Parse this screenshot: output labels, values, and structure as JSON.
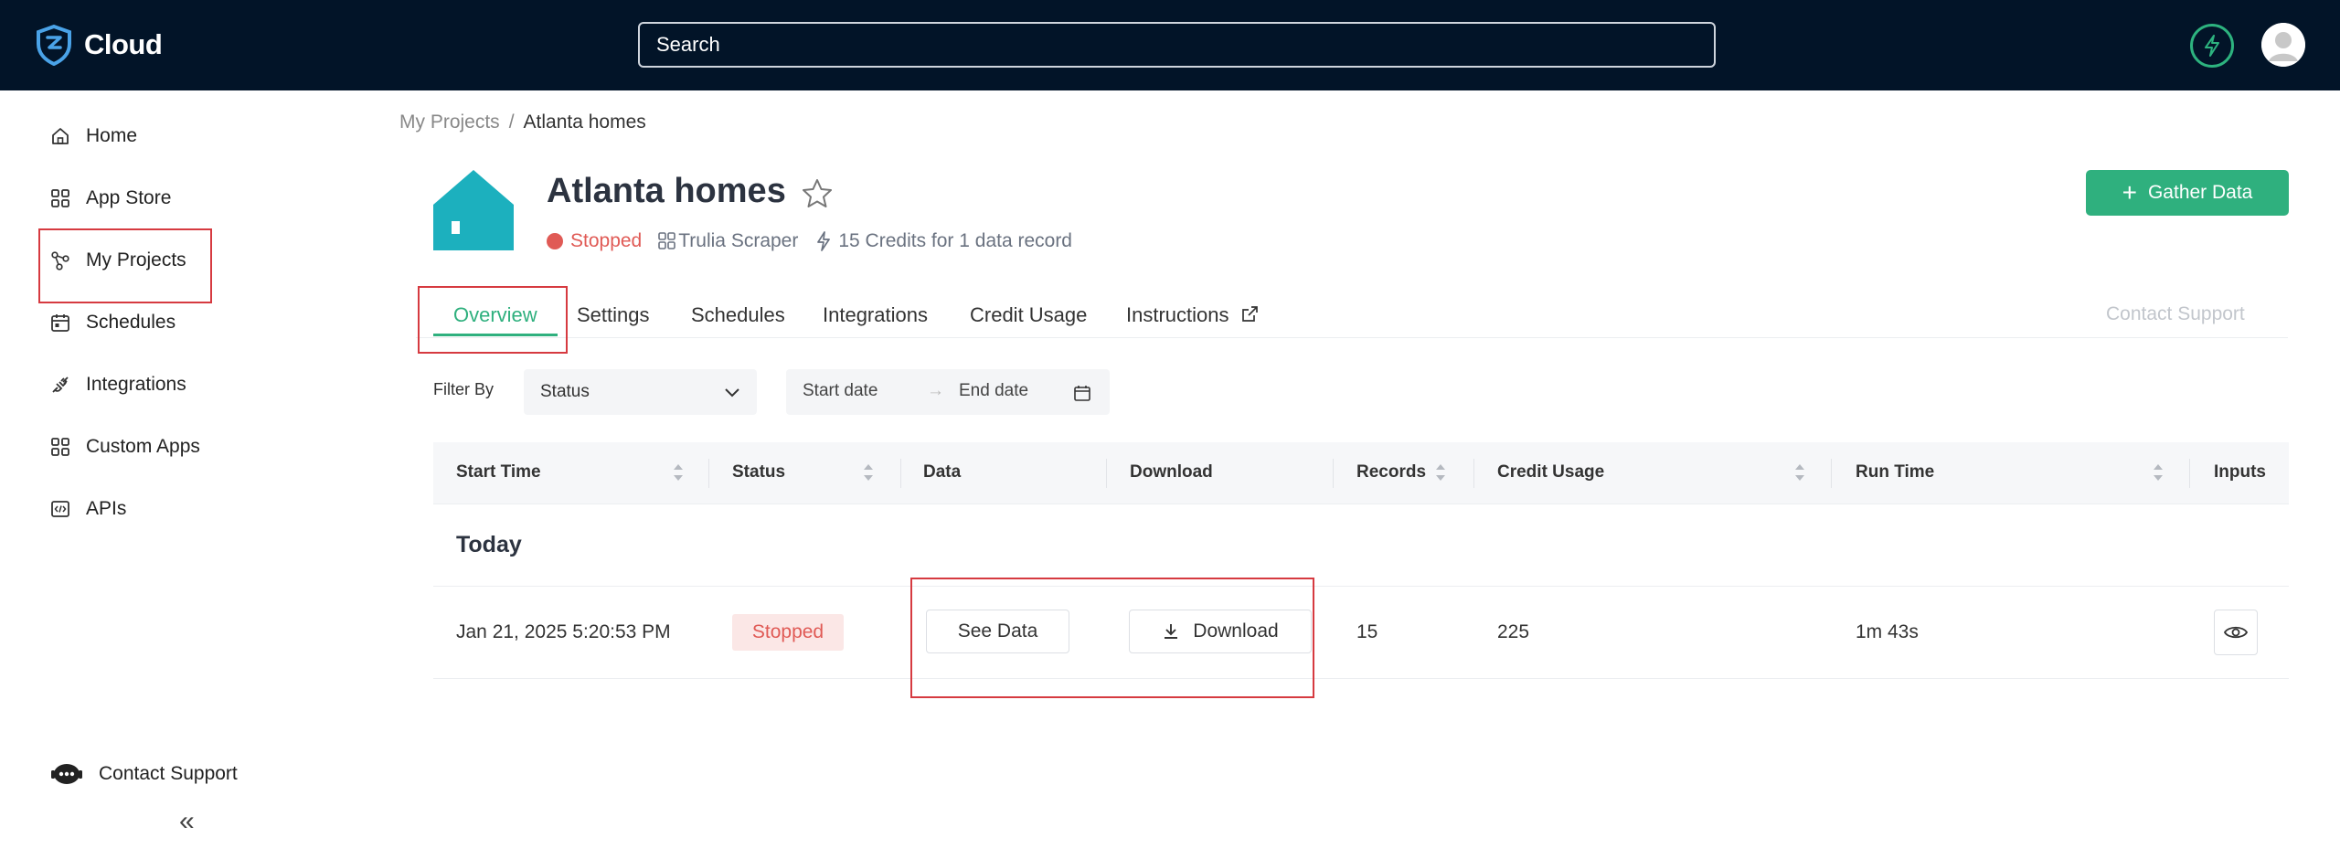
{
  "app": {
    "name": "Cloud"
  },
  "search": {
    "placeholder": "Search"
  },
  "sidebar": {
    "items": [
      {
        "label": "Home",
        "icon": "home-icon"
      },
      {
        "label": "App Store",
        "icon": "grid-icon"
      },
      {
        "label": "My Projects",
        "icon": "projects-icon"
      },
      {
        "label": "Schedules",
        "icon": "calendar-icon"
      },
      {
        "label": "Integrations",
        "icon": "plug-icon"
      },
      {
        "label": "Custom Apps",
        "icon": "grid-icon"
      },
      {
        "label": "APIs",
        "icon": "code-icon"
      }
    ],
    "contact_support": "Contact Support",
    "collapse": "«"
  },
  "breadcrumb": {
    "parent": "My Projects",
    "separator": "/",
    "current": "Atlanta homes"
  },
  "project": {
    "title": "Atlanta homes",
    "status": "Stopped",
    "scraper": "Trulia Scraper",
    "credits": "15 Credits for 1 data record"
  },
  "actions": {
    "gather_data": "Gather Data",
    "contact_support": "Contact Support"
  },
  "tabs": [
    "Overview",
    "Settings",
    "Schedules",
    "Integrations",
    "Credit Usage",
    "Instructions"
  ],
  "filter": {
    "label": "Filter By",
    "status": "Status",
    "start_placeholder": "Start date",
    "end_placeholder": "End date"
  },
  "table": {
    "columns": [
      "Start Time",
      "Status",
      "Data",
      "Download",
      "Records",
      "Credit Usage",
      "Run Time",
      "Inputs"
    ],
    "group": "Today",
    "rows": [
      {
        "start_time": "Jan 21, 2025 5:20:53 PM",
        "status": "Stopped",
        "data_button": "See Data",
        "download_button": "Download",
        "records": "15",
        "credit_usage": "225",
        "run_time": "1m 43s"
      }
    ]
  },
  "colors": {
    "topbar": "#021428",
    "accent": "#2fb07e",
    "stopped": "#e05a55",
    "highlight": "#d63a40"
  }
}
